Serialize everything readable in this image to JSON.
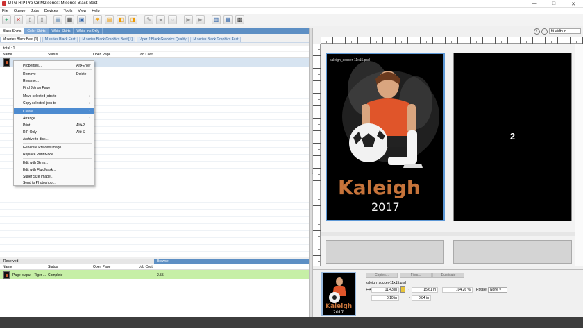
{
  "app": {
    "title": "DTG RIP Pro C8 M2 series: M series Black Best",
    "win_controls": [
      "—",
      "□",
      "✕"
    ]
  },
  "menu": [
    "File",
    "Queue",
    "Jobs",
    "Devices",
    "Tools",
    "View",
    "Help"
  ],
  "queue_tabs": [
    "Black Shirts",
    "Color Shirts",
    "White Shirts",
    "White Ink Only"
  ],
  "profile_tabs": [
    "M series Black Best [1]",
    "M series Black Fast",
    "M series Black Graphics Best [1]",
    "Viper 2 Black Graphics Quality",
    "M series Black Graphics Fast"
  ],
  "total_label": "total : 1",
  "job_columns": [
    "Name",
    "Status",
    "Open Page",
    "Job Cost"
  ],
  "context_menu": {
    "properties": {
      "label": "Properties...",
      "shortcut": "Alt+Enter"
    },
    "remove": {
      "label": "Remove",
      "shortcut": "Delete"
    },
    "rename": "Rename...",
    "find": "Find Job on Page",
    "move": "Move selected jobs to",
    "copy": "Copy selected jobs to",
    "create": "Create",
    "arrange": "Arrange",
    "print": {
      "label": "Print",
      "shortcut": "Alt+P"
    },
    "rip_only": {
      "label": "RIP Only",
      "shortcut": "Alt+S"
    },
    "archive": "Archive to disk...",
    "gen_preview": "Generate Preview Image",
    "replace_print_mode": "Replace Print Mode...",
    "edit_gimp": "Edit with Gimp...",
    "edit_fluid": "Edit with FluidMask...",
    "super_size": "Super Size Image...",
    "send_ps": "Send to Photoshop..."
  },
  "reserved_label": "Reserved",
  "browse_label": "Browse",
  "reserved_columns": [
    "Name",
    "Status",
    "Open Page",
    "Job Cost"
  ],
  "reserved_row": {
    "name": "Page output - Tiger ...",
    "status": "Complete",
    "cost": "2.55"
  },
  "zoom": {
    "select": "fit width"
  },
  "preview": {
    "filename": "kaleigh_soccer-11x15.psd",
    "page2_number": "2"
  },
  "props": {
    "filename": "kaleigh_soccer-11x15.psd",
    "buttons": [
      "Copies...",
      "Files...",
      "Duplicate"
    ],
    "width": "11.43 in",
    "height": "15.61 in",
    "scale": "104.26 %",
    "x_offset": "0.10 in",
    "y_offset": "0.84 in",
    "rotate_label": "Rotate",
    "rotate_value": "None"
  }
}
